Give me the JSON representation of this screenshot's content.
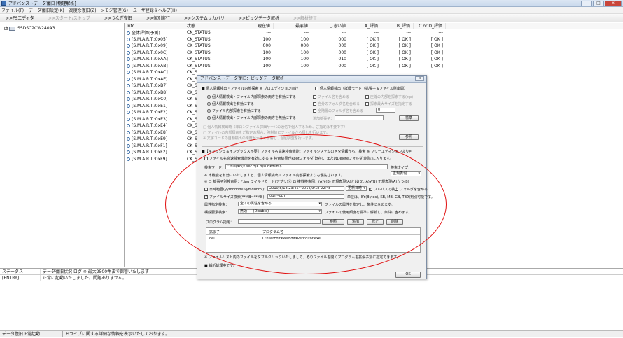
{
  "window": {
    "title": "アドバンストデータ復旧 [物理解析]"
  },
  "menu": [
    "ファイル(F)",
    "データ復旧設定(K)",
    "高度な復旧(Z)",
    ">モジ管理(G)",
    "ユーザ登録＆ヘルプ(H)"
  ],
  "toolbar": {
    "items": [
      ">>FSエディタ",
      ">>スタート/ストップ",
      ">>つなぎ復旧",
      ">>個別実行",
      ">>システムリカバリ",
      ">>ビッグデータ解析",
      ">>解析終了"
    ],
    "disabled": [
      1,
      6
    ]
  },
  "tree": {
    "drive": "SSDSC2CW240A3"
  },
  "list": {
    "headers": [
      "Info.",
      "状態",
      "現在値",
      "最悪値",
      "しきい値",
      "A_評価",
      "B_評価",
      "C or D_評価"
    ],
    "rows": [
      [
        "全体評価(予測)",
        "CK_STATUS",
        "---",
        "---",
        "---",
        "---",
        "---",
        "---"
      ],
      [
        "[S.M.A.R.T.:0x05]",
        "CK_STATUS",
        "100",
        "100",
        "000",
        "[ OK ]",
        "[ OK ]",
        "[ OK ]"
      ],
      [
        "[S.M.A.R.T.:0x09]",
        "CK_STATUS",
        "000",
        "000",
        "000",
        "[ OK ]",
        "[ OK ]",
        "[ OK ]"
      ],
      [
        "[S.M.A.R.T.:0x0C]",
        "CK_STATUS",
        "100",
        "100",
        "000",
        "[ OK ]",
        "[ OK ]",
        "[ OK ]"
      ],
      [
        "[S.M.A.R.T.:0xAA]",
        "CK_STATUS",
        "100",
        "100",
        "010",
        "[ OK ]",
        "[ OK ]",
        "[ OK ]"
      ],
      [
        "[S.M.A.R.T.:0xAB]",
        "CK_STATUS",
        "100",
        "100",
        "000",
        "[ OK ]",
        "[ OK ]",
        "[ OK ]"
      ],
      [
        "[S.M.A.R.T.:0xAC]",
        "CK_S",
        "",
        "",
        "",
        "",
        "",
        ""
      ],
      [
        "[S.M.A.R.T.:0xAE]",
        "CK_S",
        "",
        "",
        "",
        "",
        "",
        ""
      ],
      [
        "[S.M.A.R.T.:0xB7]",
        "CK_S",
        "",
        "",
        "",
        "",
        "",
        ""
      ],
      [
        "[S.M.A.R.T.:0xB8]",
        "CK_S",
        "",
        "",
        "",
        "",
        "",
        ""
      ],
      [
        "[S.M.A.R.T.:0xC0]",
        "CK_S",
        "",
        "",
        "",
        "",
        "",
        ""
      ],
      [
        "[S.M.A.R.T.:0xE1]",
        "CK_S",
        "",
        "",
        "",
        "",
        "",
        ""
      ],
      [
        "[S.M.A.R.T.:0xE2]",
        "CK_S",
        "",
        "",
        "",
        "",
        "",
        ""
      ],
      [
        "[S.M.A.R.T.:0xE3]",
        "CK_S",
        "",
        "",
        "",
        "",
        "",
        ""
      ],
      [
        "[S.M.A.R.T.:0xE4]",
        "CK_S",
        "",
        "",
        "",
        "",
        "",
        ""
      ],
      [
        "[S.M.A.R.T.:0xE8]",
        "CK_S",
        "",
        "",
        "",
        "",
        "",
        ""
      ],
      [
        "[S.M.A.R.T.:0xE9]",
        "CK_S",
        "",
        "",
        "",
        "",
        "",
        ""
      ],
      [
        "[S.M.A.R.T.:0xF1]",
        "CK_S",
        "",
        "",
        "",
        "",
        "",
        ""
      ],
      [
        "[S.M.A.R.T.:0xF2]",
        "CK_S",
        "",
        "",
        "",
        "",
        "",
        ""
      ],
      [
        "[S.M.A.R.T.:0xF9]",
        "CK_S",
        "",
        "",
        "",
        "",
        "",
        ""
      ]
    ]
  },
  "status": {
    "headers": [
      "ステータス",
      "データ復旧状況 ログ ※ 最大2500件まで保管いたします"
    ],
    "row": [
      "[ENTRY]",
      "正常に起動いたしました。問題ありません。"
    ]
  },
  "statusbar": [
    "データ復旧正常起動",
    "ドライブに関する詳細な情報を表示いたしております。"
  ],
  "dialog": {
    "title": "アドバンストデータ復旧：ビッグデータ解析",
    "close": "ⅹ",
    "mode1": "■ 個人情報検出・ファイル内部探索 ※ プロエディション向け",
    "mode2": "個人情報検出（詳細モード（拡張子＆ファイル財産開）",
    "radio1": "個人情報検出・ファイル内部探索の両方を有効にする",
    "radio2": "個人情報検出を有効にする",
    "radio3": "ファイル内部探索を有効にする",
    "radio4": "個人情報検出・ファイル内部探索の両方を無効にする",
    "opt_a": "ファイル名を含める",
    "opt_b": "圧縮の内部を探索する(zip)",
    "opt_c": "自分のフォルダ名を含める",
    "opt_d": "探索最大サイズを指定する",
    "opt_e": "全階層のフォルダ名を含める",
    "opt_e_val": "0",
    "opt_f": "追加拡張子：",
    "opt_f_btn": "標準",
    "note1": "□ 個人情報検出時（非ロンファイル詳細サーバの通信で個人するため、ご指定は不要です）",
    "note2": "□ ファイルの内部探索をご指定の場合、強制的にファイルから探しを行います。",
    "note3": "※ 文字コードの自動検出の精度が大きく影響し、個別調査を行います。",
    "note_btn": "参照",
    "cache_line": "■【キャッシュ＆インデックス不要】ファイル名高速検索機能：ファイルシステムのメタ情報から、検索 ※ フリーエディションより可",
    "fname_line": "ファイル名高速検索機能を有効にする ※ 検索結果がRootフォルダ(既存)、またはDeleteフォルダ(削除)に入ります。",
    "search_label": "検索ワード：",
    "search_value": "^file(¥d(¥.sec.*)¥.b)sub¥dum$",
    "search_type_label": "検索タイプ：",
    "search_type": "正規表現",
    "line_note": "※ 本機能を有効にいたしますと、個人情報検出・ファイル内部探索よりも優先されます。",
    "line_ext": "※ ロ 拡張子別検索例：*.jpg ワイルドカード(アプリ)Ⓐ ロ 複数検索例：(A)¥(B) 正規表現(A)とは(B),(A)¥(B) 正規表現(A)かつ(B)",
    "date_label": "日時範囲(yymddhmi~ymddhmi):",
    "date_value": "2010/8/18 23:45~2014/9/18 22:48",
    "date_sel": "更新日時",
    "full_search": "フルパスで検索",
    "folder_incl": "フォルダを含める",
    "size_label": "ファイルサイズ検索(**MB~**MB):",
    "size_value": "0BY~0BY",
    "size_unit": "単位は、BY(Bytes), KB, MB, GB, TB的判別可能です。",
    "attr_label": "属性指定検索：",
    "attr_value": "全ての属性を含める",
    "attr_note": "ファイルの属性を指定し、条件に含めます。",
    "sig_label": "構成要素検索：",
    "sig_value": "無効 --- (Disable)",
    "sig_note": "ファイルの使用頻度を標準に解析し、条件に含めます。",
    "prog_label": "プログラム指定：",
    "btns": [
      "参照",
      "追加",
      "修正",
      "削除"
    ],
    "prog_headers": [
      "拡張子",
      "プログラム名"
    ],
    "prog_row": [
      "del",
      "C:¥PerEdit¥PerEdit¥PerEditor.exe"
    ],
    "prog_note": "※ ファイルリスト内のファイルをダブルクリックいたしまして、そのファイルを開くプログラムを拡張子別に指定できます。",
    "running": "■ 解析処理中です。",
    "ok": "OK"
  },
  "annotation_color": "#e01010"
}
